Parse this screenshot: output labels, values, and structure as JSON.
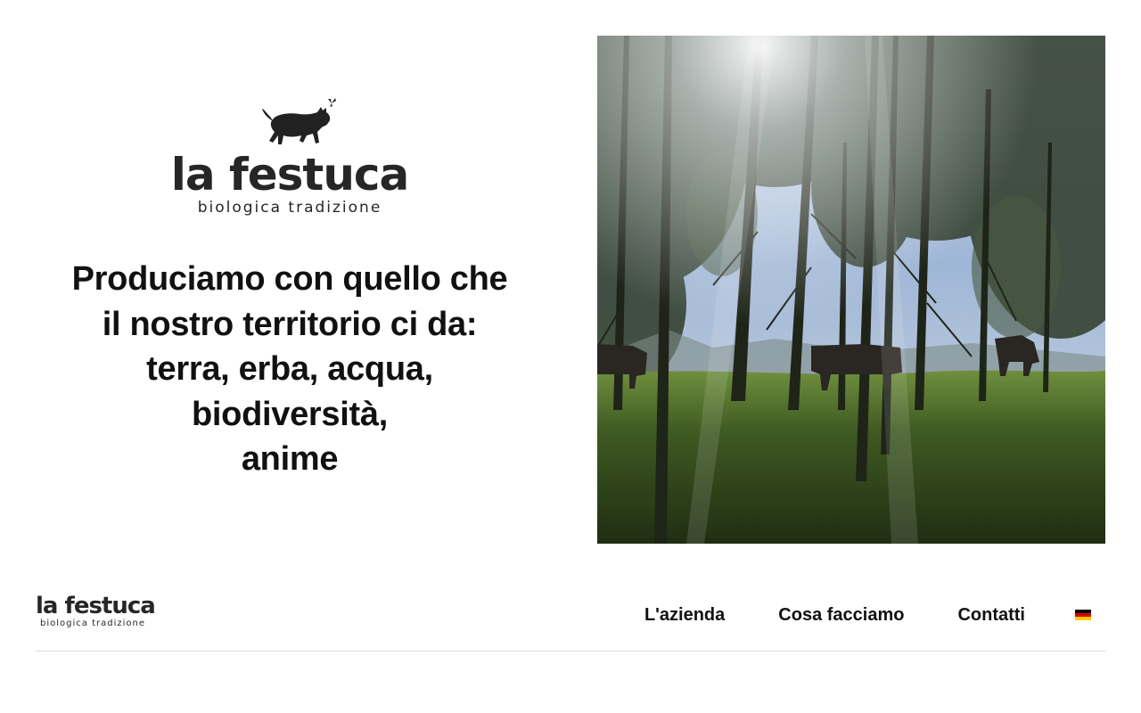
{
  "hero": {
    "brand_name": "la festuca",
    "brand_tagline": "biologica tradizione",
    "headline_lines": [
      "Produciamo con quello che",
      "il nostro territorio ci da:",
      "terra, erba, acqua,",
      "biodiversità,",
      "anime"
    ],
    "photo_icon": "forest-cows-photo"
  },
  "nav": {
    "logo_name": "la festuca",
    "logo_tagline": "biologica tradizione",
    "links": [
      "L'azienda",
      "Cosa facciamo",
      "Contatti"
    ],
    "language_icon": "german-flag-icon",
    "flag_colors": [
      "#000000",
      "#dd0000",
      "#ffce00"
    ]
  }
}
